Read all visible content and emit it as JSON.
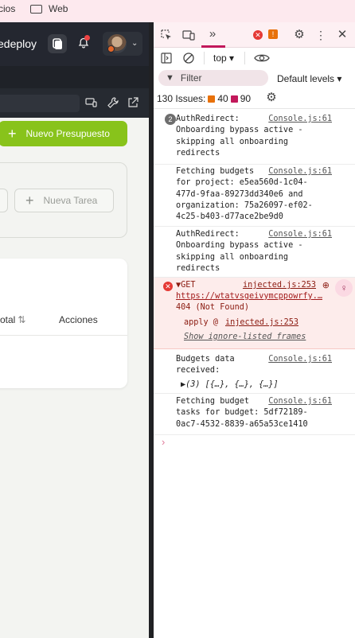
{
  "bookmarks": [
    {
      "label": "cios",
      "icon": "none"
    },
    {
      "label": "Web",
      "icon": "folder-icon"
    }
  ],
  "app": {
    "brand_text": "edeploy",
    "new_budget_label": "Nuevo Presupuesto",
    "new_task_label": "Nueva Tarea",
    "table_headers": [
      "otal",
      "Acciones"
    ],
    "sort_glyph": "⇅",
    "accent_color": "#88c31b"
  },
  "devtools": {
    "error_count_badge": "!",
    "context_selector": "top ▾",
    "filter_placeholder": "Filter",
    "levels_label": "Default levels ▾",
    "issues_label": "130 Issues:",
    "issues_warnings": "40",
    "issues_info": "90",
    "logs": [
      {
        "count": "2",
        "text": "AuthRedirect:\nOnboarding bypass active -\nskipping all onboarding\nredirects",
        "source": "Console.js:61"
      },
      {
        "text": "Fetching budgets\nfor project: e5ea560d-1c04-\n477d-9faa-89273dd340e6 and\norganization: 75a26097-ef02-\n4c25-b403-d77ace2be9d0",
        "source": "Console.js:61"
      },
      {
        "text": "AuthRedirect:\nOnboarding bypass active -\nskipping all onboarding\nredirects",
        "source": "Console.js:61"
      },
      {
        "type": "error",
        "method": "▼GET",
        "url": "https://wtatvsgeivymcppowrfy.…",
        "status": "404 (Not Found)",
        "stack": "apply @",
        "stack_source": "injected.js:253",
        "source": "injected.js:253",
        "ignore_link": "Show ignore-listed frames"
      },
      {
        "text": "Budgets data\nreceived:",
        "source": "Console.js:61",
        "array": "▶(3) [{…}, {…}, {…}]"
      },
      {
        "text": "Fetching budget\ntasks for budget: 5df72189-\n0ac7-4532-8839-a65a53ce1410",
        "source": "Console.js:61"
      }
    ],
    "prompt": "›"
  }
}
